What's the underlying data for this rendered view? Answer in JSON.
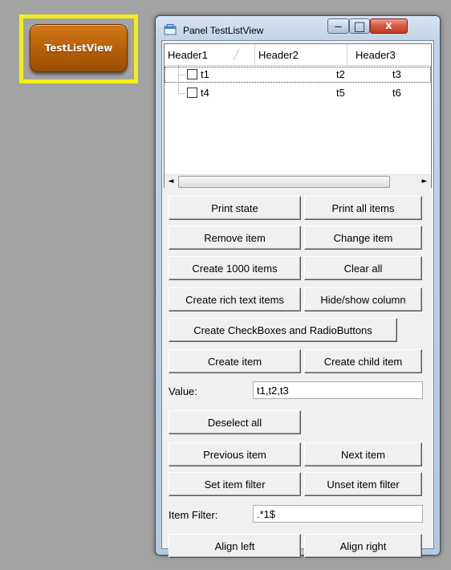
{
  "launcher": {
    "label": "TestListView"
  },
  "window": {
    "title": "Panel TestListView",
    "controls": {
      "minimize": "‒",
      "maximize": "□",
      "close": "x"
    }
  },
  "listview": {
    "headers": [
      "Header1",
      "Header2",
      "Header3"
    ],
    "rows": [
      {
        "c1": "t1",
        "c2": "t2",
        "c3": "t3"
      },
      {
        "c1": "t4",
        "c2": "t5",
        "c3": "t6"
      }
    ],
    "scroll_left": "◄",
    "scroll_right": "►"
  },
  "buttons": {
    "print_state": "Print state",
    "print_all_items": "Print all items",
    "remove_item": "Remove item",
    "change_item": "Change item",
    "create_1000_items": "Create 1000 items",
    "clear_all": "Clear all",
    "create_rich_text_items": "Create rich text items",
    "hide_show_column": "Hide/show column",
    "create_checkboxes_radiobuttons": "Create CheckBoxes and RadioButtons",
    "create_item": "Create item",
    "create_child_item": "Create child item",
    "deselect_all": "Deselect all",
    "previous_item": "Previous item",
    "next_item": "Next item",
    "set_item_filter": "Set item filter",
    "unset_item_filter": "Unset item filter",
    "align_left": "Align left",
    "align_right": "Align right"
  },
  "value": {
    "label": "Value:",
    "text": "t1,t2,t3"
  },
  "item_filter": {
    "label": "Item Filter:",
    "text": ".*1$"
  }
}
